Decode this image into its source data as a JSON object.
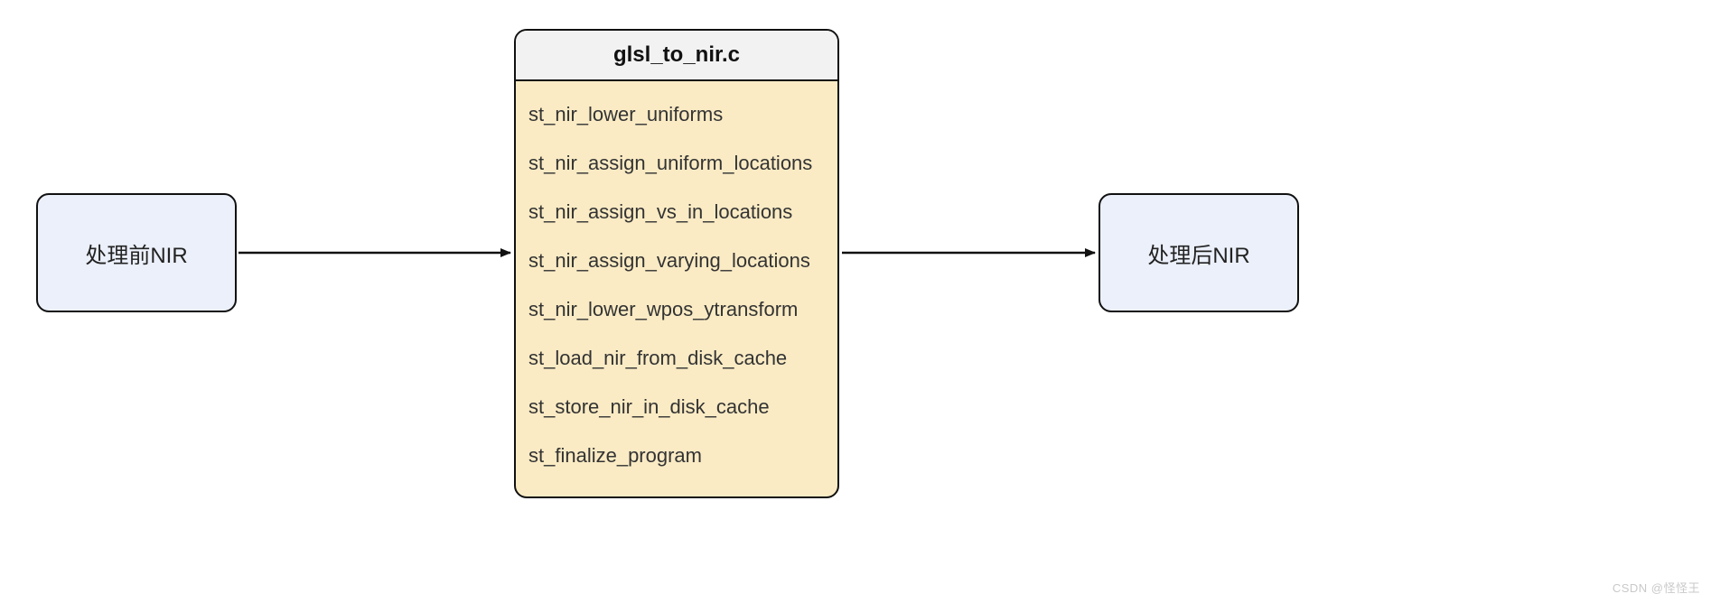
{
  "left_node": {
    "label": "处理前NIR"
  },
  "right_node": {
    "label": "处理后NIR"
  },
  "center": {
    "header": "glsl_to_nir.c",
    "items": [
      "st_nir_lower_uniforms",
      "st_nir_assign_uniform_locations",
      "st_nir_assign_vs_in_locations",
      "st_nir_assign_varying_locations",
      "st_nir_lower_wpos_ytransform",
      "st_load_nir_from_disk_cache",
      "st_store_nir_in_disk_cache",
      "st_finalize_program"
    ]
  },
  "watermark": "CSDN @怪怪王"
}
